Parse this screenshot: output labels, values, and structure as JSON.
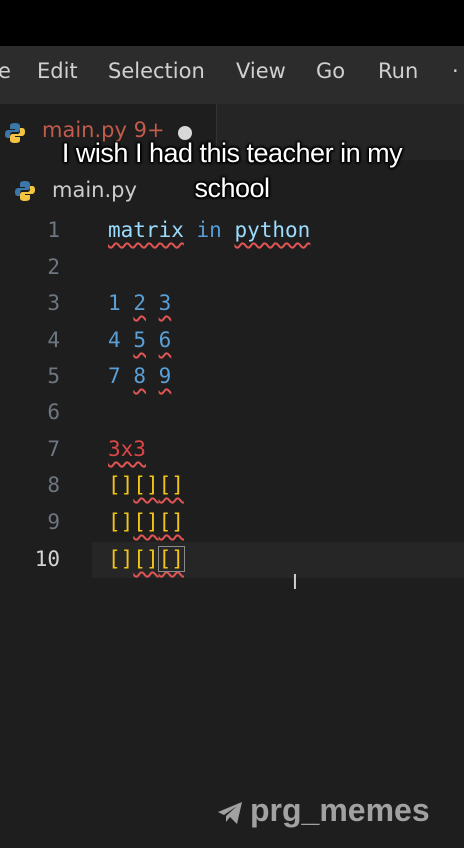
{
  "menu": {
    "items": [
      {
        "label": "e"
      },
      {
        "label": "Edit"
      },
      {
        "label": "Selection"
      },
      {
        "label": "View"
      },
      {
        "label": "Go"
      },
      {
        "label": "Run"
      },
      {
        "label": "·"
      }
    ]
  },
  "tab": {
    "label": "main.py 9+",
    "icon": "python-icon",
    "dirty_indicator": "dot"
  },
  "caption": {
    "line1": "I wish I had this teacher in my",
    "line2": "school"
  },
  "breadcrumb": {
    "file": "main.py",
    "icon": "python-icon"
  },
  "editor": {
    "line_numbers": [
      "1",
      "2",
      "3",
      "4",
      "5",
      "6",
      "7",
      "8",
      "9",
      "10"
    ],
    "active_line": "10",
    "lines": {
      "l1": {
        "w1": "matrix",
        "w2": "in",
        "w3": "python"
      },
      "l3": {
        "a": "1",
        "b": "2",
        "c": "3"
      },
      "l4": {
        "a": "4",
        "b": "5",
        "c": "6"
      },
      "l5": {
        "a": "7",
        "b": "8",
        "c": "9"
      },
      "l7": {
        "text": "3x3"
      },
      "l8": {
        "p1": "[]",
        "p2": "[]",
        "p3": "[]"
      },
      "l9": {
        "p1": "[]",
        "p2": "[]",
        "p3": "[]"
      },
      "l10": {
        "p1": "[]",
        "p2": "[]",
        "p3": "[]"
      }
    },
    "colors": {
      "identifier": "#9cdcfe",
      "keyword": "#569cd6",
      "number": "#5a9fd6",
      "red_text": "#e04646",
      "brackets": "#f2c418",
      "error_squiggle": "#e05454"
    }
  },
  "watermark": {
    "text": "prg_memes",
    "icon": "telegram-icon"
  }
}
